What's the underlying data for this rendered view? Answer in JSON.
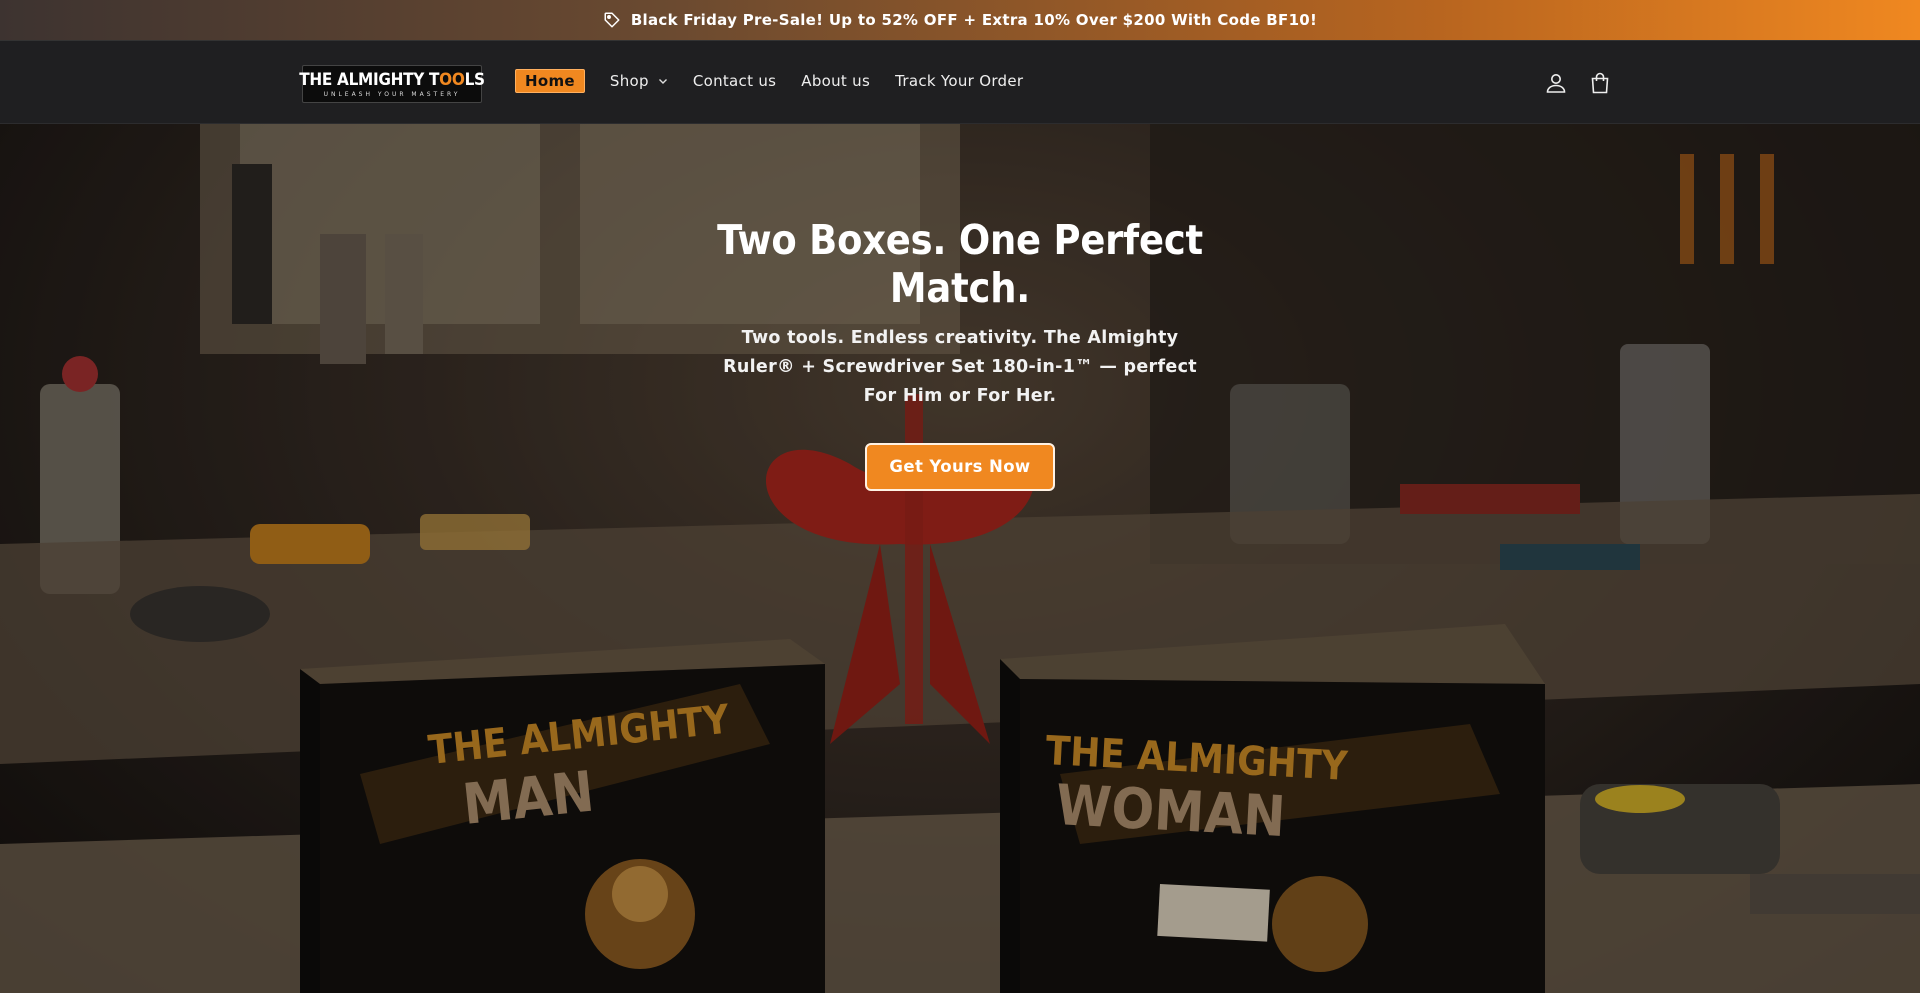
{
  "announcement": {
    "text": "Black Friday Pre-Sale! Up to 52% OFF + Extra 10% Over $200 With Code BF10!",
    "icon": "tag-icon"
  },
  "header": {
    "logo": {
      "brand_text": "THE ALMIGHTY TOOLS",
      "tagline": "UNLEASH YOUR MASTERY"
    },
    "nav": {
      "home": "Home",
      "shop": "Shop",
      "contact": "Contact us",
      "about": "About us",
      "track": "Track Your Order"
    },
    "icons": [
      "account-icon",
      "cart-icon"
    ]
  },
  "hero": {
    "title": "Two Boxes. One Perfect Match.",
    "subtitle": "Two tools. Endless creativity. The Almighty Ruler® + Screwdriver Set 180-in-1™ — perfect For Him or For Her.",
    "cta": "Get Yours Now",
    "box_left": {
      "top": "THE ALMIGHTY",
      "bottom": "MAN"
    },
    "box_right": {
      "top": "THE ALMIGHTY",
      "bottom": "WOMAN"
    }
  },
  "colors": {
    "accent": "#f08820",
    "header_bg": "#1f1f21"
  }
}
